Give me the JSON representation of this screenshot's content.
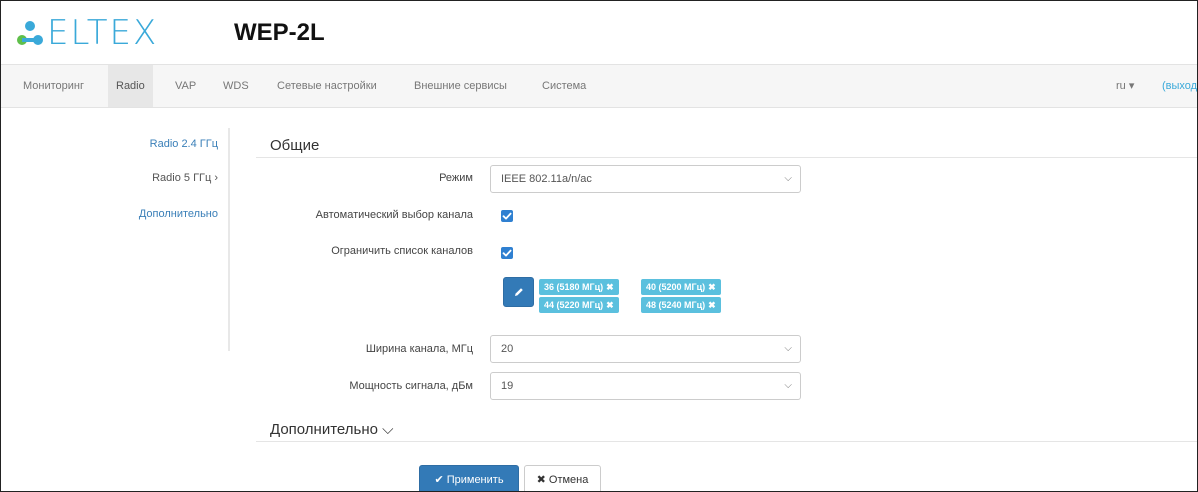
{
  "header": {
    "logo_text": "ELTEX",
    "device_title": "WEP-2L"
  },
  "navbar": {
    "items": [
      {
        "label": "Мониторинг"
      },
      {
        "label": "Radio"
      },
      {
        "label": "VAP"
      },
      {
        "label": "WDS"
      },
      {
        "label": "Сетевые настройки"
      },
      {
        "label": "Внешние сервисы"
      },
      {
        "label": "Система"
      }
    ],
    "active": "Radio",
    "language": "ru ▾",
    "logout": "(выход)"
  },
  "sidebar": {
    "items": [
      {
        "label": "Radio 2.4 ГГц"
      },
      {
        "label": "Radio 5 ГГц ›"
      },
      {
        "label": "Дополнительно"
      }
    ],
    "active": "Radio 5 ГГц ›"
  },
  "main": {
    "section_general": "Общие",
    "mode_label": "Режим",
    "mode_value": "IEEE 802.11a/n/ac",
    "auto_channel_label": "Автоматический выбор канала",
    "auto_channel_checked": true,
    "limit_channels_label": "Ограничить список каналов",
    "limit_channels_checked": true,
    "channels": [
      {
        "label": "36 (5180 МГц)"
      },
      {
        "label": "40 (5200 МГц)"
      },
      {
        "label": "44 (5220 МГц)"
      },
      {
        "label": "48 (5240 МГц)"
      }
    ],
    "width_label": "Ширина канала, МГц",
    "width_value": "20",
    "power_label": "Мощность сигнала, дБм",
    "power_value": "19",
    "section_advanced": "Дополнительно ⌵"
  },
  "buttons": {
    "apply": "✔ Применить",
    "cancel": "✖ Отмена"
  },
  "colors": {
    "accent": "#3aa9d9",
    "primary": "#337ab7",
    "chip": "#5bc0de",
    "checkbox": "#2f80d1"
  },
  "icons": {
    "edit": "pencil-icon",
    "chevron": "chevron-down-icon",
    "remove": "close-icon"
  }
}
